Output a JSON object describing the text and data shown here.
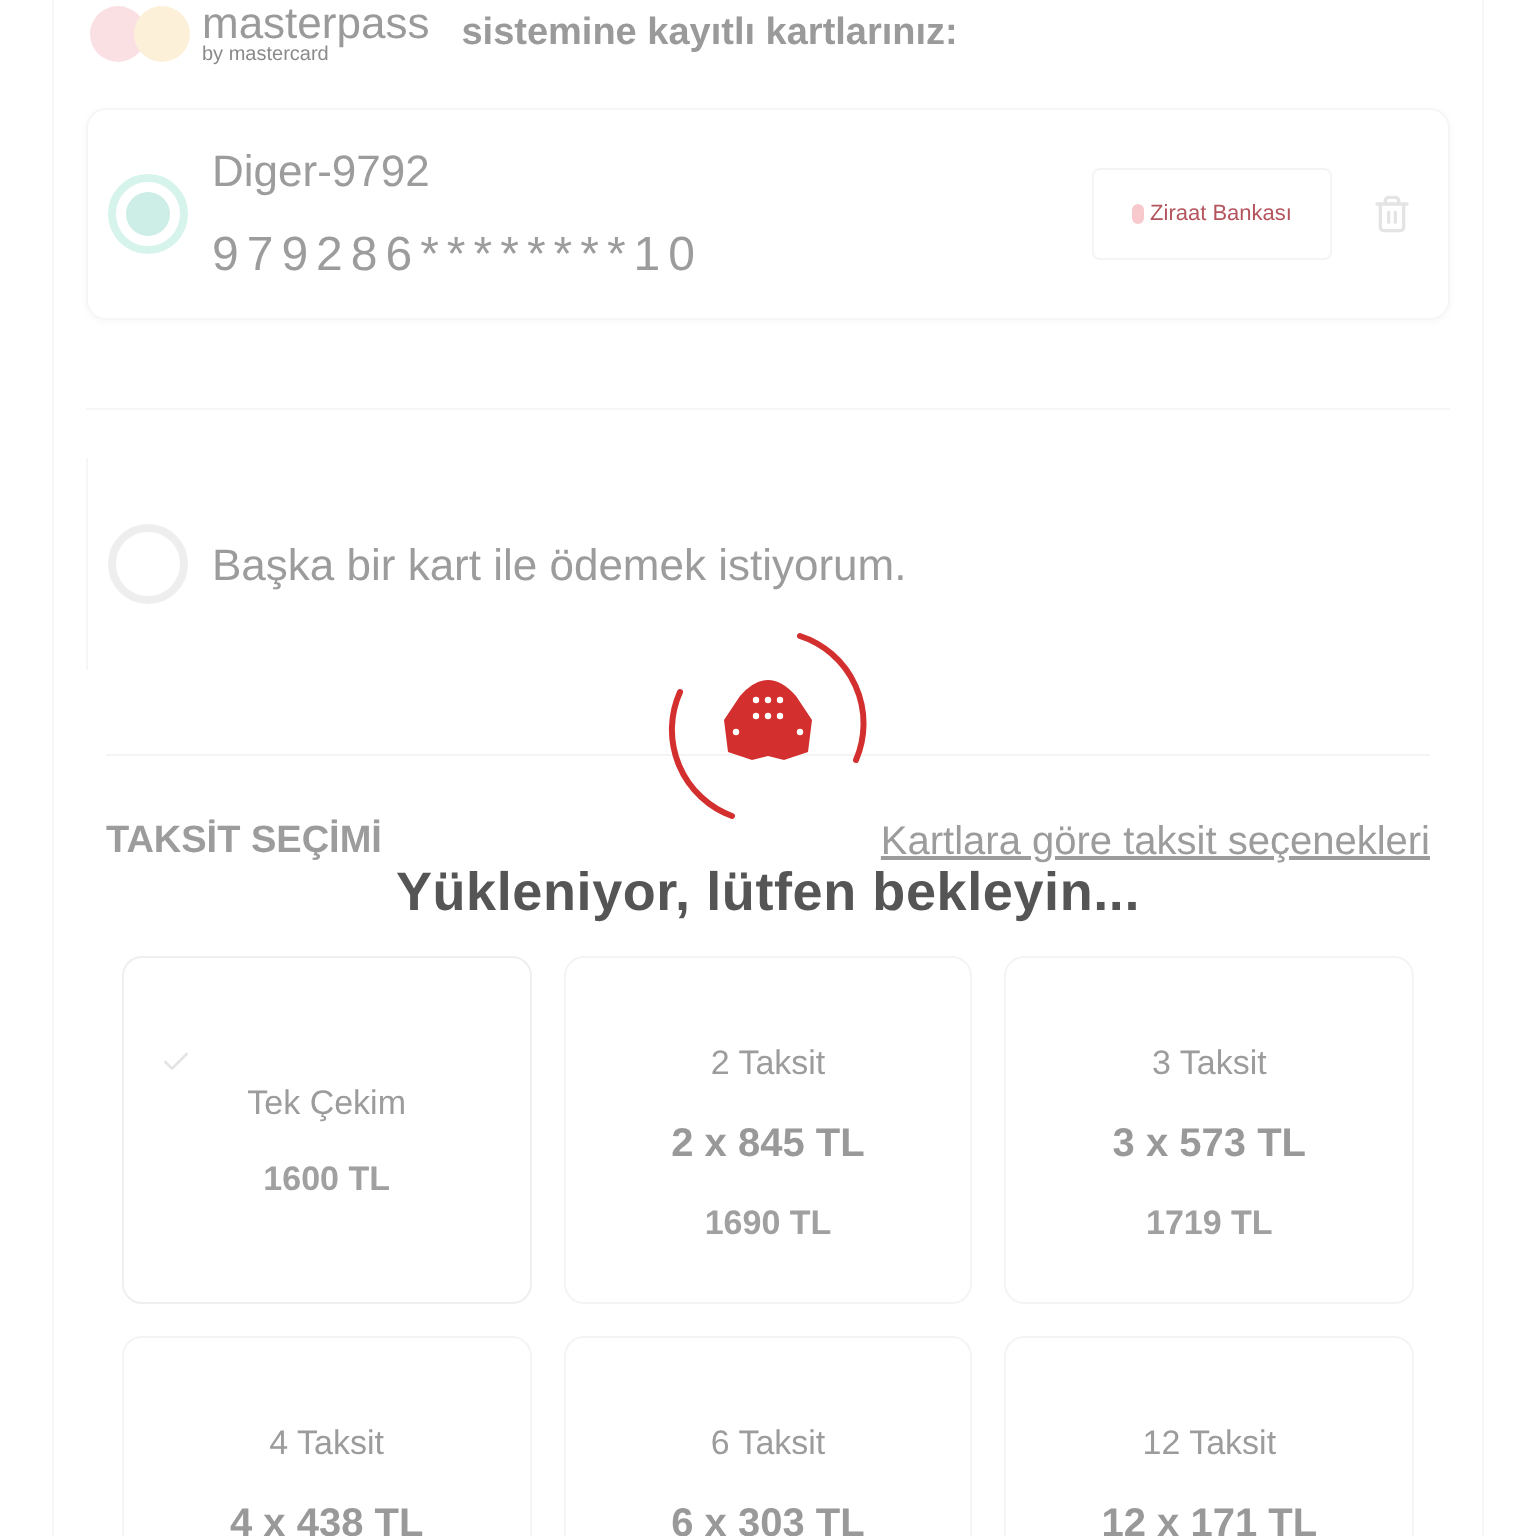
{
  "header": {
    "logo_name": "masterpass",
    "logo_sub": "by mastercard",
    "title": "sistemine kayıtlı kartlarınız:"
  },
  "saved_cards": [
    {
      "name": "Diger-9792",
      "number": "979286********10",
      "bank": "Ziraat Bankası",
      "selected": true
    }
  ],
  "other_card": {
    "label": "Başka bir kart ile ödemek istiyorum.",
    "selected": false
  },
  "installments": {
    "title": "TAKSİT SEÇİMİ",
    "link": "Kartlara göre taksit seçenekleri",
    "options": [
      {
        "label": "Tek Çekim",
        "total": "1600 TL",
        "selected": true
      },
      {
        "label": "2 Taksit",
        "monthly": "2 x 845 TL",
        "total": "1690 TL",
        "selected": false
      },
      {
        "label": "3 Taksit",
        "monthly": "3 x 573 TL",
        "total": "1719 TL",
        "selected": false
      },
      {
        "label": "4 Taksit",
        "monthly": "4 x 438 TL",
        "selected": false
      },
      {
        "label": "6 Taksit",
        "monthly": "6 x 303 TL",
        "selected": false
      },
      {
        "label": "12 Taksit",
        "monthly": "12 x 171 TL",
        "selected": false
      }
    ]
  },
  "loading": {
    "message": "Yükleniyor, lütfen bekleyin..."
  }
}
